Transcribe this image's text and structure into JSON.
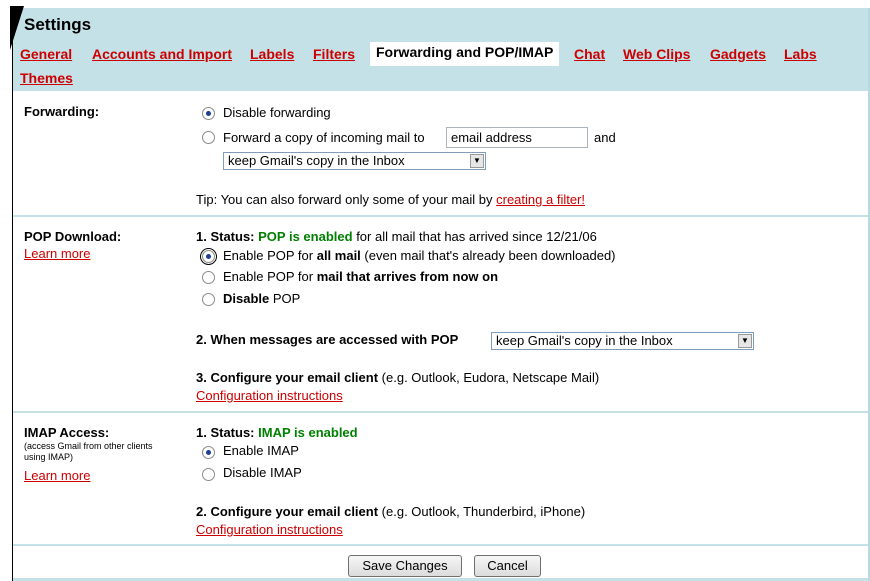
{
  "header": {
    "title": "Settings",
    "tabs": [
      {
        "label": "General",
        "active": false
      },
      {
        "label": "Accounts and Import",
        "active": false
      },
      {
        "label": "Labels",
        "active": false
      },
      {
        "label": "Filters",
        "active": false
      },
      {
        "label": "Forwarding and POP/IMAP",
        "active": true
      },
      {
        "label": "Chat",
        "active": false
      },
      {
        "label": "Web Clips",
        "active": false
      },
      {
        "label": "Gadgets",
        "active": false
      },
      {
        "label": "Labs",
        "active": false
      },
      {
        "label": "Themes",
        "active": false
      }
    ]
  },
  "forwarding": {
    "label": "Forwarding:",
    "option_disable": "Disable forwarding",
    "option_forward_prefix": "Forward a copy of incoming mail to",
    "email_value": "email address",
    "and_text": "and",
    "copy_select": "keep Gmail's copy in the Inbox",
    "tip_text": "Tip: You can also forward only some of your mail by",
    "tip_link": "creating a filter!",
    "selected": "disable"
  },
  "pop": {
    "label": "POP Download:",
    "learn_more": "Learn more",
    "status_prefix": "1. Status:",
    "status_value": "POP is enabled",
    "status_suffix": "for all mail that has arrived since 12/21/06",
    "opt1_prefix": "Enable POP for",
    "opt1_bold": "all mail",
    "opt1_suffix": "(even mail that's already been downloaded)",
    "opt2_prefix": "Enable POP for",
    "opt2_bold": "mail that arrives from now on",
    "opt3_bold": "Disable",
    "opt3_suffix": "POP",
    "step2_label": "2. When messages are accessed with POP",
    "step2_select": "keep Gmail's copy in the Inbox",
    "step3_bold": "3. Configure your email client",
    "step3_suffix": "(e.g. Outlook, Eudora, Netscape Mail)",
    "config_link": "Configuration instructions",
    "selected": "all"
  },
  "imap": {
    "label": "IMAP Access:",
    "sub_line1": "(access Gmail from other clients",
    "sub_line2": "using IMAP)",
    "learn_more": "Learn more",
    "status_prefix": "1. Status:",
    "status_value": "IMAP is enabled",
    "opt_enable": "Enable IMAP",
    "opt_disable": "Disable IMAP",
    "step2_bold": "2. Configure your email client",
    "step2_suffix": "(e.g. Outlook, Thunderbird, iPhone)",
    "config_link": "Configuration instructions",
    "selected": "enable"
  },
  "footer": {
    "save_label": "Save Changes",
    "cancel_label": "Cancel"
  }
}
